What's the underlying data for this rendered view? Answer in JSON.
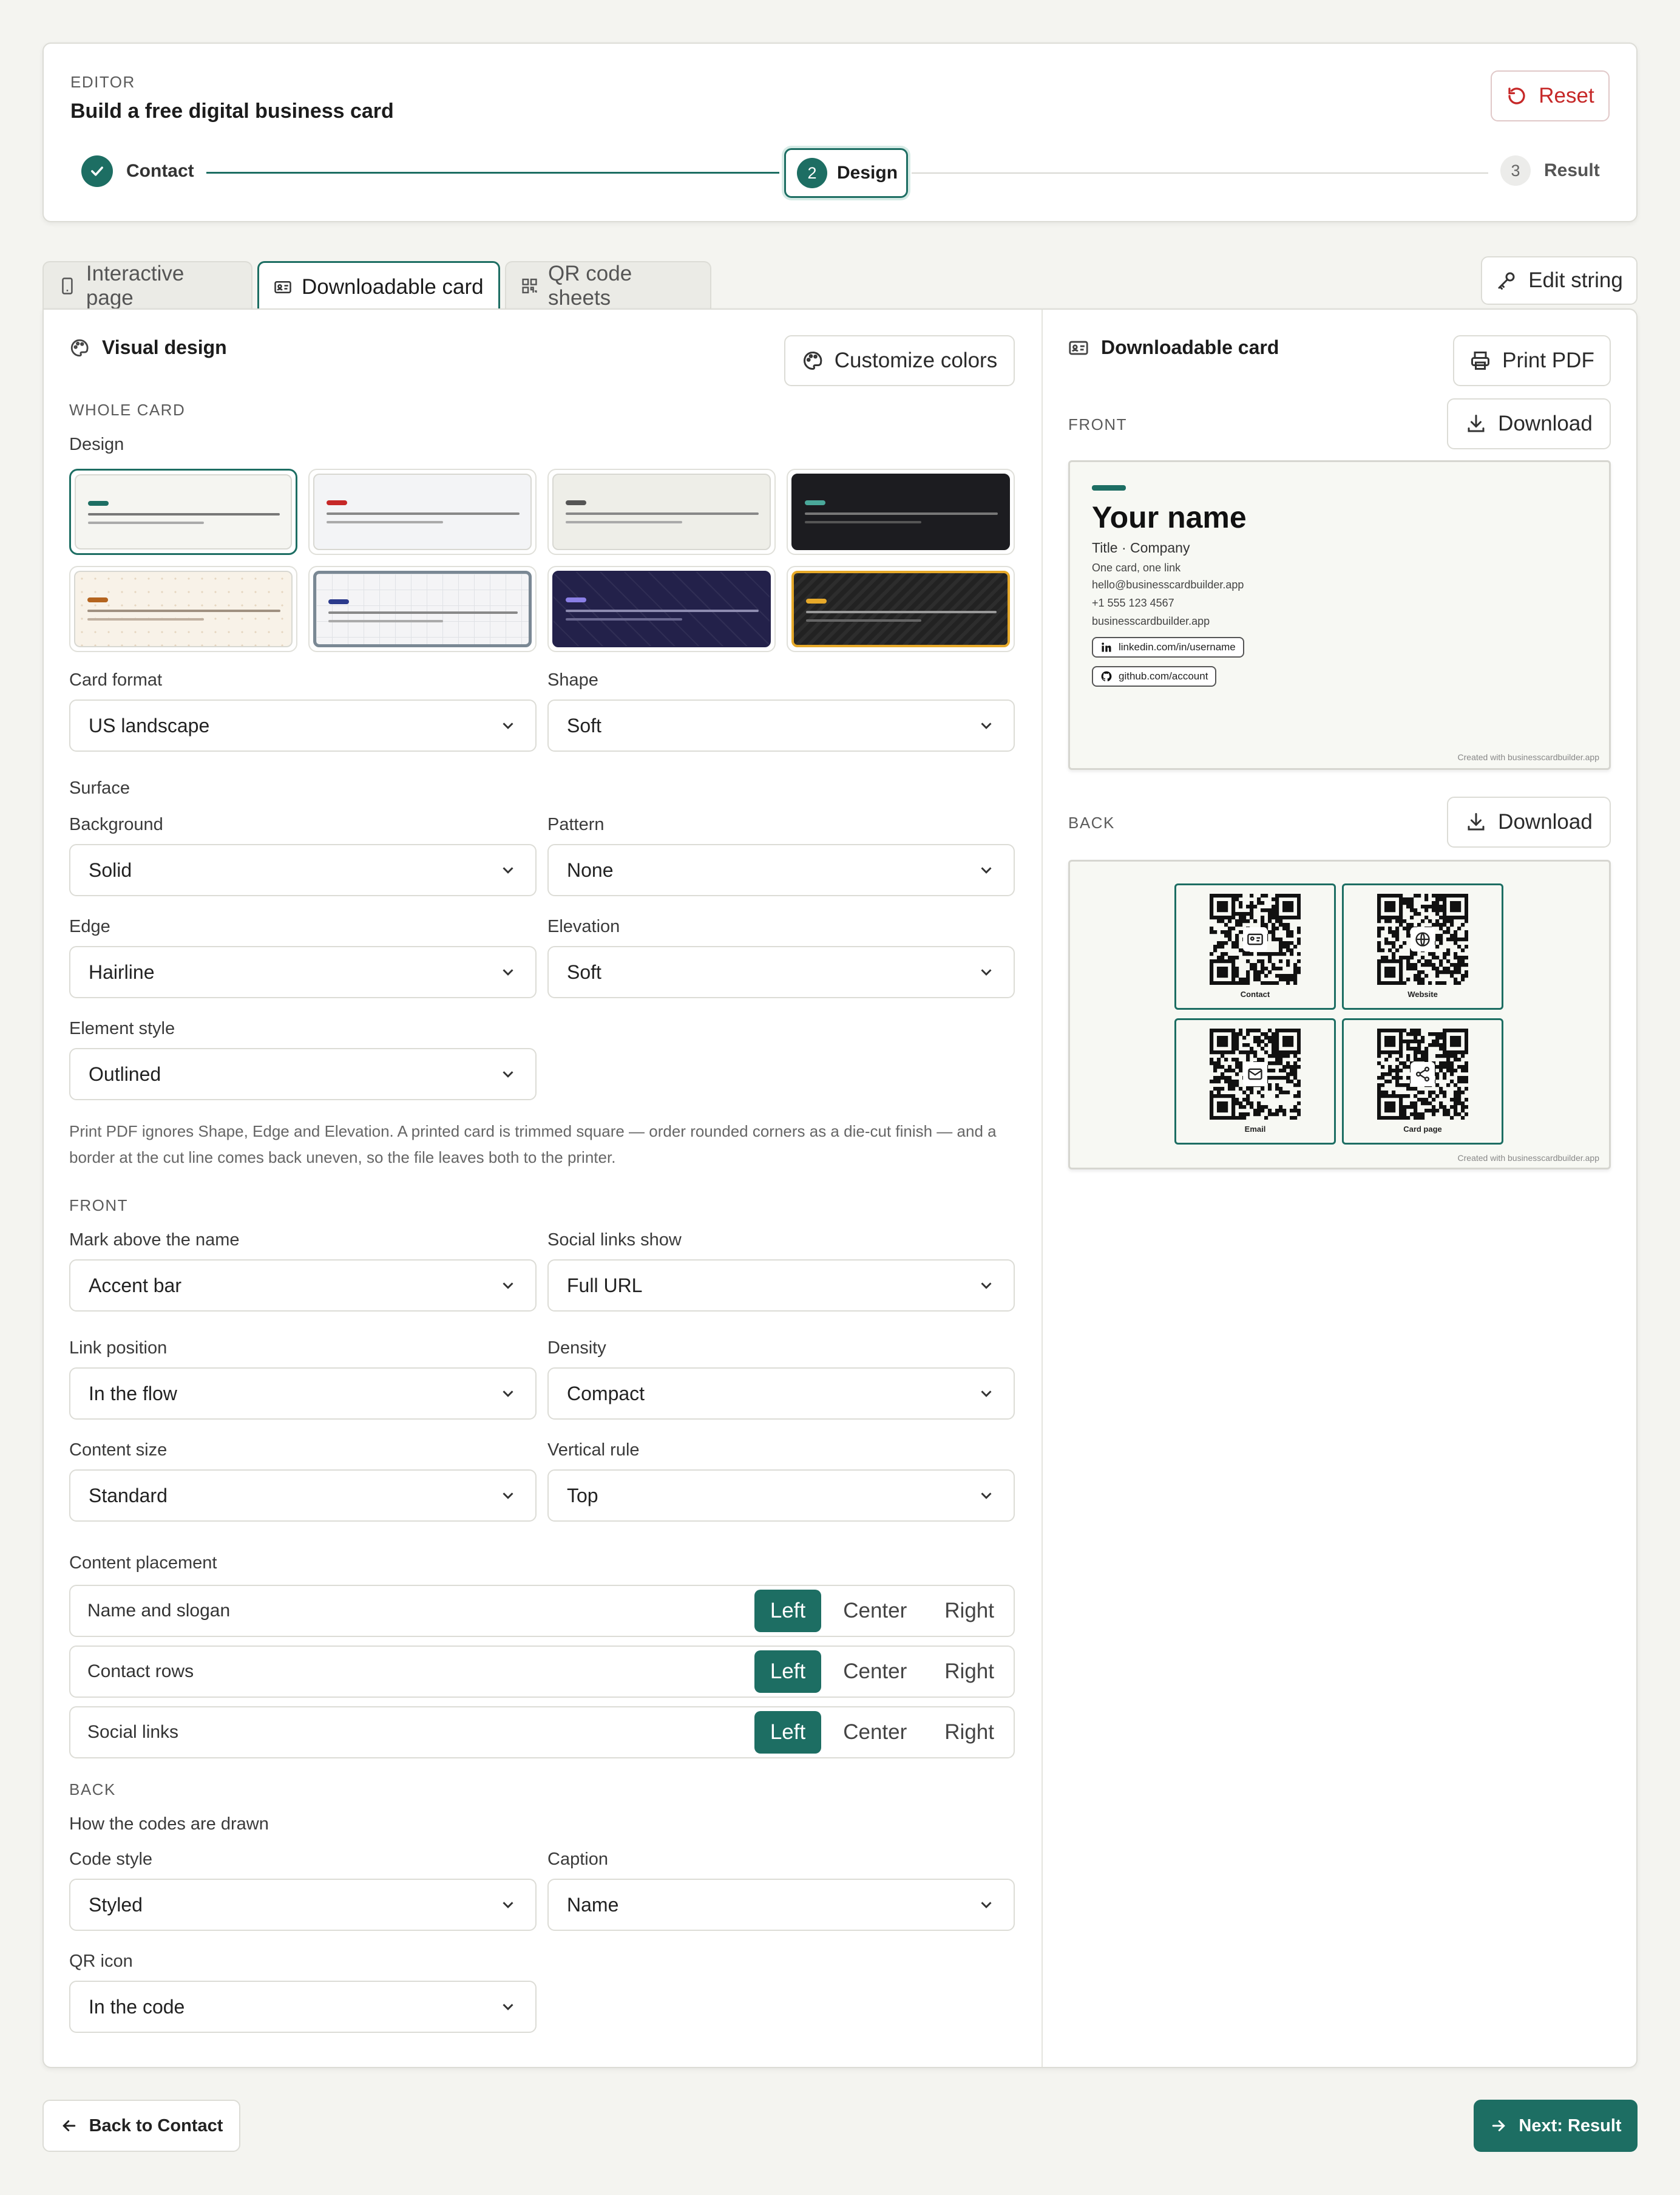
{
  "header": {
    "kicker": "EDITOR",
    "title": "Build a free digital business card",
    "reset": "Reset"
  },
  "steps": [
    {
      "label": "Contact",
      "state": "done"
    },
    {
      "num": "2",
      "label": "Design",
      "state": "active"
    },
    {
      "num": "3",
      "label": "Result",
      "state": "todo"
    }
  ],
  "tabs": [
    {
      "label": "Interactive page",
      "icon": "phone-icon"
    },
    {
      "label": "Downloadable card",
      "icon": "id-card-icon"
    },
    {
      "label": "QR code sheets",
      "icon": "qr-icon"
    }
  ],
  "edit_string": "Edit string",
  "design": {
    "title": "Visual design",
    "customize": "Customize colors",
    "whole_card": "WHOLE CARD",
    "design_label": "Design",
    "swatches": [
      {
        "bg": "#f5f5f1",
        "accent": "#1d6e63",
        "line": "#777"
      },
      {
        "bg": "#f3f4f6",
        "accent": "#c62828",
        "line": "#888"
      },
      {
        "bg": "#eeeee8",
        "accent": "#555",
        "line": "#888"
      },
      {
        "bg": "#1c1c20",
        "accent": "#4aa89a",
        "line": "#777"
      },
      {
        "bg": "#f8f2e8",
        "accent": "#b4641e",
        "line": "#a09080"
      },
      {
        "bg": "#f4f4f6",
        "accent": "#2b3a8c",
        "line": "#888"
      },
      {
        "bg": "#23214a",
        "accent": "#8a7fe6",
        "line": "#8d8bb0"
      },
      {
        "bg": "#222",
        "accent": "#e6a92a",
        "line": "#999"
      }
    ],
    "card_format": {
      "label": "Card format",
      "value": "US landscape"
    },
    "shape": {
      "label": "Shape",
      "value": "Soft"
    },
    "surface": "Surface",
    "background": {
      "label": "Background",
      "value": "Solid"
    },
    "pattern": {
      "label": "Pattern",
      "value": "None"
    },
    "edge": {
      "label": "Edge",
      "value": "Hairline"
    },
    "elevation": {
      "label": "Elevation",
      "value": "Soft"
    },
    "element_style": {
      "label": "Element style",
      "value": "Outlined"
    },
    "note": "Print PDF ignores Shape, Edge and Elevation. A printed card is trimmed square — order rounded corners as a die-cut finish — and a border at the cut line comes back uneven, so the file leaves both to the printer.",
    "front": "FRONT",
    "mark": {
      "label": "Mark above the name",
      "value": "Accent bar"
    },
    "social_show": {
      "label": "Social links show",
      "value": "Full URL"
    },
    "link_position": {
      "label": "Link position",
      "value": "In the flow"
    },
    "density": {
      "label": "Density",
      "value": "Compact"
    },
    "content_size": {
      "label": "Content size",
      "value": "Standard"
    },
    "vertical_rule": {
      "label": "Vertical rule",
      "value": "Top"
    },
    "placement_label": "Content placement",
    "placement": [
      {
        "label": "Name and slogan",
        "options": [
          "Left",
          "Center",
          "Right"
        ],
        "selected": "Left"
      },
      {
        "label": "Contact rows",
        "options": [
          "Left",
          "Center",
          "Right"
        ],
        "selected": "Left"
      },
      {
        "label": "Social links",
        "options": [
          "Left",
          "Center",
          "Right"
        ],
        "selected": "Left"
      }
    ],
    "back": "BACK",
    "codes_drawn": "How the codes are drawn",
    "code_style": {
      "label": "Code style",
      "value": "Styled"
    },
    "caption": {
      "label": "Caption",
      "value": "Name"
    },
    "qr_icon": {
      "label": "QR icon",
      "value": "In the code"
    }
  },
  "preview": {
    "title": "Downloadable card",
    "print": "Print PDF",
    "front": "FRONT",
    "back": "BACK",
    "download": "Download",
    "card": {
      "name": "Your name",
      "title": "Title · Company",
      "slogan": "One card, one link",
      "email": "hello@businesscardbuilder.app",
      "phone": "+1 555 123 4567",
      "site": "businesscardbuilder.app",
      "linkedin": "linkedin.com/in/username",
      "github": "github.com/account",
      "credit": "Created with businesscardbuilder.app"
    },
    "codes": [
      {
        "caption": "Contact",
        "icon": "id-card-icon"
      },
      {
        "caption": "Website",
        "icon": "globe-icon"
      },
      {
        "caption": "Email",
        "icon": "mail-icon"
      },
      {
        "caption": "Card page",
        "icon": "share-icon"
      }
    ]
  },
  "footer": {
    "back": "Back to Contact",
    "next": "Next: Result"
  },
  "colors": {
    "accent": "#1d6e63",
    "danger": "#c62828"
  }
}
